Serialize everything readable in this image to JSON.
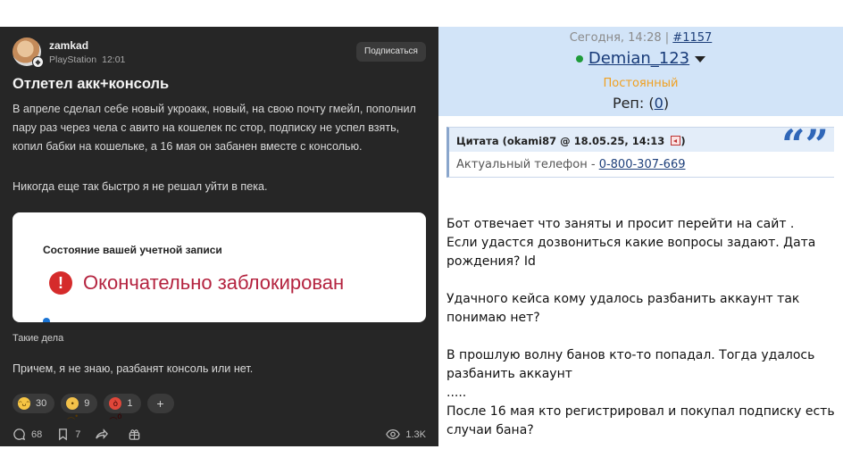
{
  "left": {
    "author": "zamkad",
    "platform": "PlayStation",
    "time": "12:01",
    "subscribe_label": "Подписаться",
    "title": "Отлетел акк+консоль",
    "paragraph1": "В апреле сделал себе новый укроакк, новый, на свою почту гмейл, пополнил пару раз через чела с авито на кошелек пс стор, подписку не успел взять, копил бабки на кошельке, а 16 мая он забанен вместе с консолью.",
    "paragraph2": "Никогда еще так быстро я не решал уйти в пека.",
    "card": {
      "title": "Состояние вашей учетной записи",
      "icon": "!",
      "status": "Окончательно заблокирован"
    },
    "caption": "Такие дела",
    "paragraph3": "Причем, я не знаю, разбанят консоль или нет.",
    "reactions": [
      {
        "icon": "laughing-emoji",
        "count": "30"
      },
      {
        "icon": "sad-emoji",
        "count": "9"
      },
      {
        "icon": "angry-emoji",
        "count": "1"
      }
    ],
    "add_reaction": "+",
    "comments_count": "68",
    "bookmarks_count": "7",
    "views": "1.3K"
  },
  "right": {
    "post_date": "Сегодня, 14:28",
    "separator": "|",
    "post_number": "#1157",
    "username": "Demian_123",
    "user_status": "Постоянный",
    "rep_label": "Реп:",
    "rep_open": "(",
    "rep_value": "0",
    "rep_close": ")",
    "quote_header": "Цитата (okami87 @ 18.05.25, 14:13",
    "quote_header_close": ")",
    "quote_marks": "“”",
    "quote_text": "Актуальный телефон - ",
    "quote_phone": "0-800-307-669",
    "message": "Бот отвечает что заняты и просит перейти на сайт .\nЕсли удастся дозвониться какие вопросы задают. Дата рождения? Id\n\nУдачного кейса кому удалось разбанить аккаунт так понимаю нет?\n\nВ прошлую волну банов кто-то попадал. Тогда удалось разбанить аккаунт\n.....\nПосле 16 мая кто регистрировал и покупал подписку есть случаи бана?"
  }
}
